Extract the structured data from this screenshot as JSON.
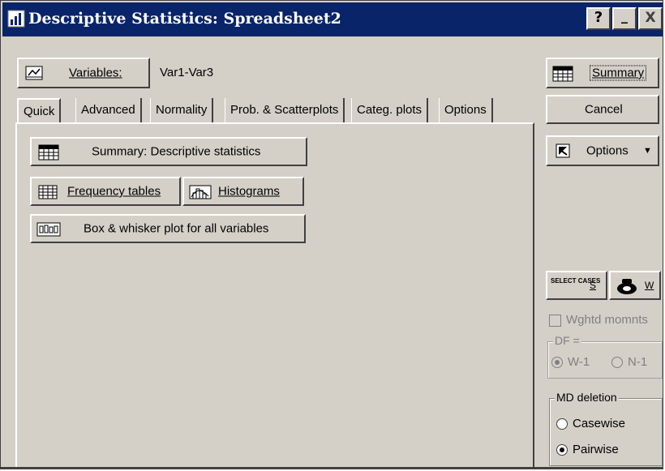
{
  "window": {
    "title": "Descriptive Statistics: Spreadsheet2",
    "help_label": "?",
    "minimize_label": "_",
    "close_label": "X"
  },
  "variables": {
    "button_label": "Variables:",
    "value": "Var1-Var3"
  },
  "tabs": [
    {
      "label": "Quick",
      "active": true
    },
    {
      "label": "Advanced",
      "active": false
    },
    {
      "label": "Normality",
      "active": false
    },
    {
      "label": "Prob. & Scatterplots",
      "active": false
    },
    {
      "label": "Categ. plots",
      "active": false
    },
    {
      "label": "Options",
      "active": false
    }
  ],
  "quick": {
    "summary_label": "Summary: Descriptive statistics",
    "frequency_label": "Frequency tables",
    "histograms_label": "Histograms",
    "boxplot_label": "Box & whisker plot for all variables"
  },
  "side": {
    "summary_label": "Summary",
    "cancel_label": "Cancel",
    "options_label": "Options",
    "select_cases_label": "SELECT CASES",
    "select_s": "S",
    "weight_w": "W",
    "wghtd_label": "Wghtd momnts",
    "df_label": "DF =",
    "df_w1": "W-1",
    "df_n1": "N-1",
    "md_label": "MD deletion",
    "casewise_label": "Casewise",
    "pairwise_label": "Pairwise"
  },
  "colors": {
    "titlebar": "#0a246a",
    "face": "#d4d0c8"
  }
}
